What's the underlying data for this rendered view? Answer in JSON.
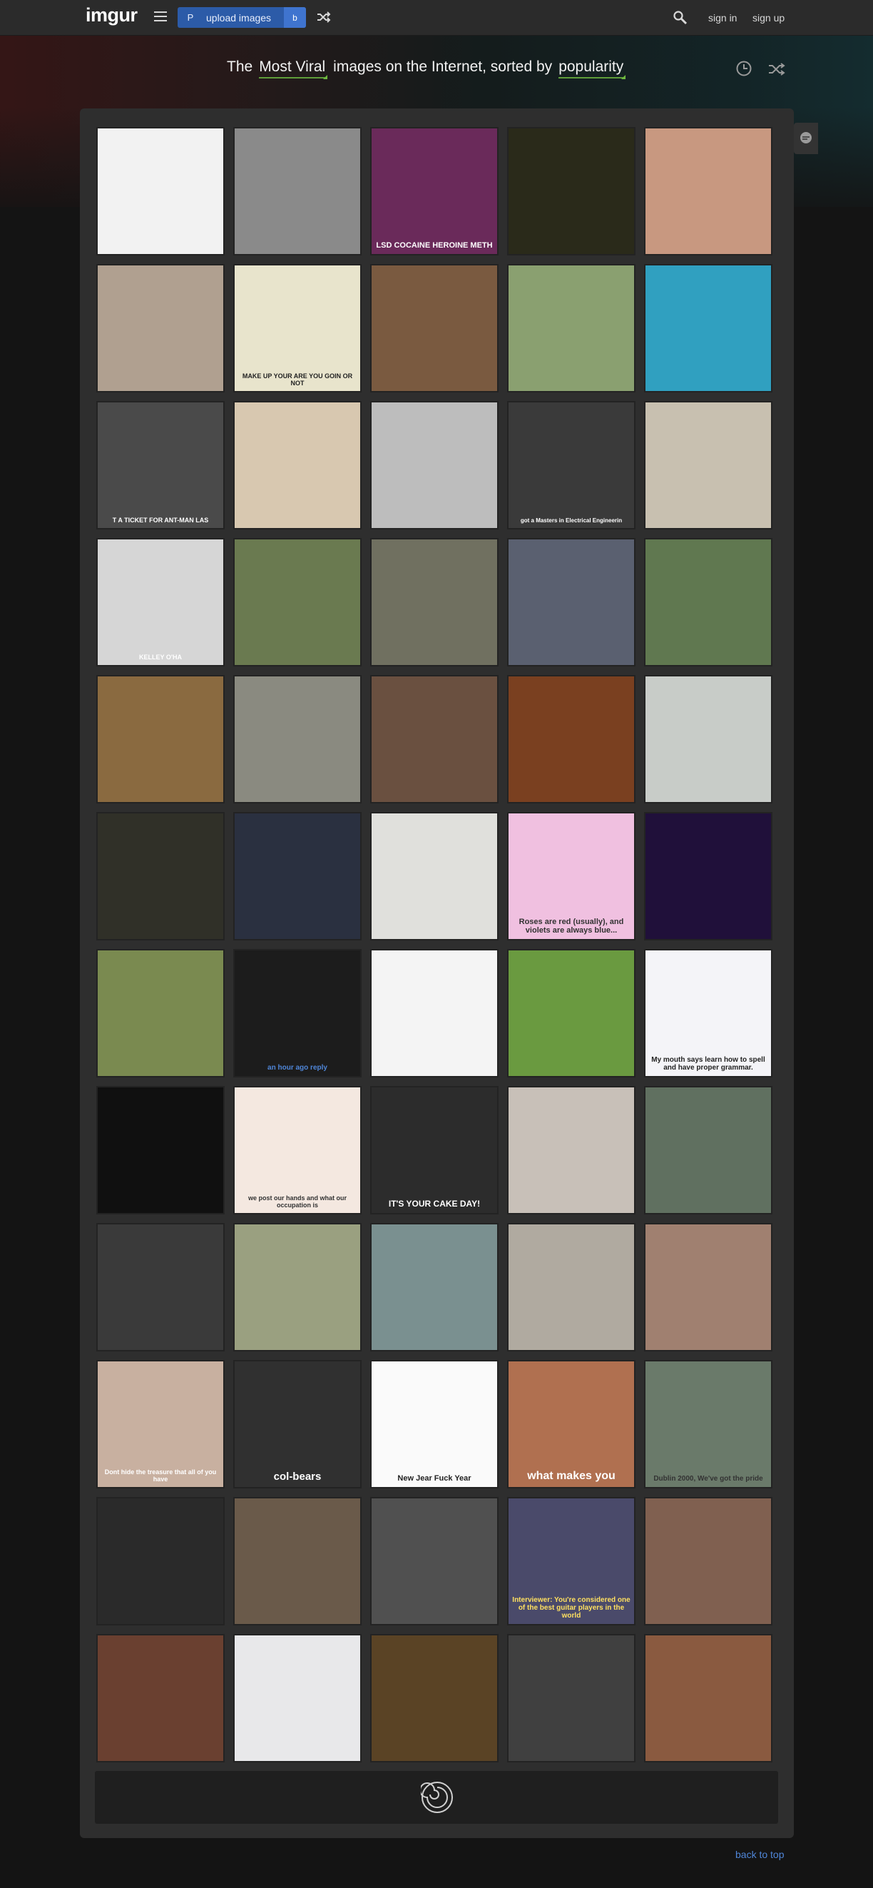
{
  "brand": {
    "logo": "imgur"
  },
  "nav": {
    "upload_key": "P",
    "upload_label": "upload images",
    "upload_shortcut": "b",
    "sign_in": "sign in",
    "sign_up": "sign up"
  },
  "headline": {
    "prefix": "The",
    "section": "Most Viral",
    "middle": "images on the Internet, sorted by",
    "sort": "popularity"
  },
  "icons": {
    "menu": "hamburger-icon",
    "shuffle": "shuffle-icon",
    "search": "search-icon",
    "clock": "clock-icon",
    "chat": "chat-bubble-icon",
    "spinner": "spinner-icon"
  },
  "colors": {
    "accent_green": "#5f9e3a",
    "upload_blue": "#2c5ba8",
    "link_blue": "#4f86d8"
  },
  "gallery": {
    "tiles": [
      {
        "caption": ""
      },
      {
        "caption": ""
      },
      {
        "caption": "LSD  COCAINE  HEROINE  METH"
      },
      {
        "caption": ""
      },
      {
        "caption": ""
      },
      {
        "caption": ""
      },
      {
        "caption": "MAKE UP YOUR ARE YOU GOIN OR NOT"
      },
      {
        "caption": ""
      },
      {
        "caption": ""
      },
      {
        "caption": ""
      },
      {
        "caption": "T A TICKET FOR ANT-MAN LAS"
      },
      {
        "caption": ""
      },
      {
        "caption": ""
      },
      {
        "caption": "got a Masters in Electrical Engineerin"
      },
      {
        "caption": ""
      },
      {
        "caption": "KELLEY O'HA"
      },
      {
        "caption": ""
      },
      {
        "caption": ""
      },
      {
        "caption": ""
      },
      {
        "caption": ""
      },
      {
        "caption": ""
      },
      {
        "caption": ""
      },
      {
        "caption": ""
      },
      {
        "caption": ""
      },
      {
        "caption": ""
      },
      {
        "caption": ""
      },
      {
        "caption": ""
      },
      {
        "caption": ""
      },
      {
        "caption": "Roses are red (usually), and violets are always blue..."
      },
      {
        "caption": ""
      },
      {
        "caption": ""
      },
      {
        "caption": "an hour ago reply"
      },
      {
        "caption": ""
      },
      {
        "caption": ""
      },
      {
        "caption": "My mouth says learn how to spell and have proper grammar."
      },
      {
        "caption": ""
      },
      {
        "caption": "we post our hands and what our occupation is"
      },
      {
        "caption": "IT'S YOUR CAKE DAY!"
      },
      {
        "caption": ""
      },
      {
        "caption": ""
      },
      {
        "caption": ""
      },
      {
        "caption": ""
      },
      {
        "caption": ""
      },
      {
        "caption": ""
      },
      {
        "caption": ""
      },
      {
        "caption": "Dont hide the treasure that all of you have"
      },
      {
        "caption": "col-bears"
      },
      {
        "caption": "New Jear Fuck Year"
      },
      {
        "caption": "what makes you"
      },
      {
        "caption": "Dublin 2000, We've got the pride"
      },
      {
        "caption": ""
      },
      {
        "caption": ""
      },
      {
        "caption": ""
      },
      {
        "caption": "Interviewer: You're considered one of the best guitar players in the world"
      },
      {
        "caption": ""
      },
      {
        "caption": ""
      },
      {
        "caption": ""
      },
      {
        "caption": ""
      },
      {
        "caption": ""
      },
      {
        "caption": ""
      }
    ]
  },
  "footer": {
    "back_to_top": "back to top"
  }
}
